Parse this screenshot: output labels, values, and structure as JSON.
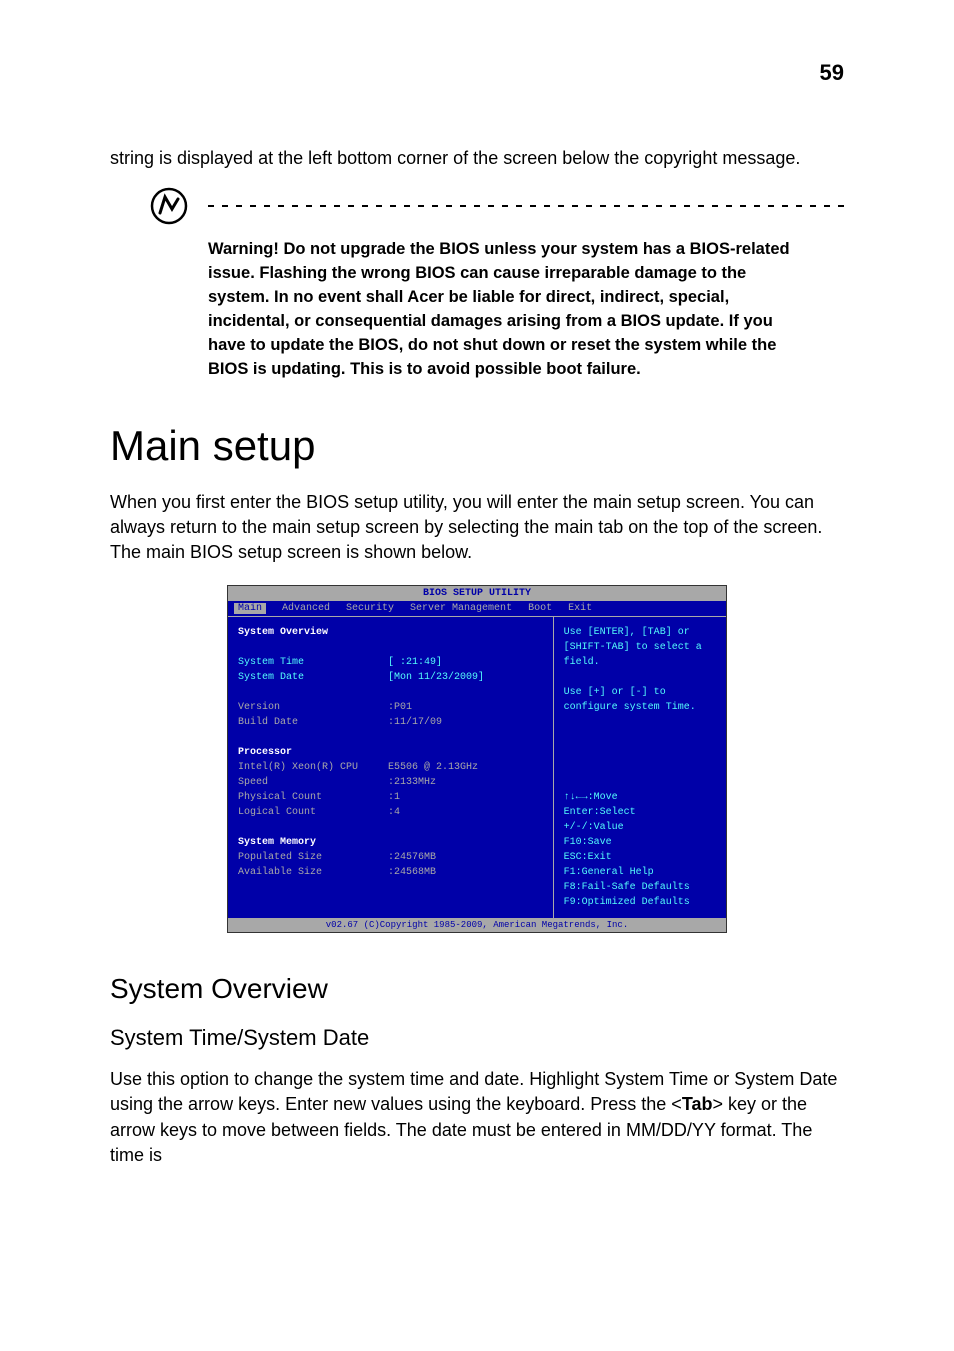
{
  "page_number": "59",
  "intro_text": "string is displayed at the left bottom corner of the screen below the copyright message.",
  "warning_text": "Warning! Do not upgrade the BIOS unless your system has a BIOS-related issue. Flashing the wrong BIOS can cause irreparable damage to the system. In no event shall Acer be liable for direct, indirect, special, incidental, or consequential damages arising from a BIOS update. If you have to update the BIOS, do not shut down or reset the system while the BIOS is updating. This is to avoid possible boot failure.",
  "main_heading": "Main setup",
  "main_body": "When you first enter the BIOS setup utility, you will enter the main setup screen. You can always return to the main setup screen by selecting the main tab on the top of the screen. The main BIOS setup screen is shown below.",
  "bios": {
    "title": "BIOS SETUP UTILITY",
    "menu": [
      "Main",
      "Advanced",
      "Security",
      "Server Management",
      "Boot",
      "Exit"
    ],
    "overview_title": "System Overview",
    "system_time_label": "System Time",
    "system_time_value": "[  :21:49]",
    "system_date_label": "System Date",
    "system_date_value": "[Mon 11/23/2009]",
    "version_label": "Version",
    "version_value": ":P01",
    "build_date_label": "Build Date",
    "build_date_value": ":11/17/09",
    "processor_title": "Processor",
    "cpu_label": "Intel(R) Xeon(R) CPU",
    "cpu_value": "E5506  @ 2.13GHz",
    "speed_label": "Speed",
    "speed_value": ":2133MHz",
    "phys_count_label": "Physical Count",
    "phys_count_value": ":1",
    "log_count_label": "Logical Count",
    "log_count_value": ":4",
    "memory_title": "System Memory",
    "populated_label": "Populated Size",
    "populated_value": ":24576MB",
    "available_label": "Available Size",
    "available_value": ":24568MB",
    "help_text1": "Use [ENTER], [TAB] or [SHIFT-TAB] to select a field.",
    "help_text2": "Use [+] or [-] to configure system Time.",
    "nav_move": "↑↓←→:Move",
    "nav_select": "Enter:Select",
    "nav_value": "+/-/:Value",
    "nav_save": "F10:Save",
    "nav_exit": "ESC:Exit",
    "nav_help": "F1:General Help",
    "nav_failsafe": "F8:Fail-Safe Defaults",
    "nav_optimized": "F9:Optimized Defaults",
    "footer": "v02.67 (C)Copyright 1985-2009, American Megatrends, Inc."
  },
  "section_heading": "System Overview",
  "sub_heading": "System Time/System Date",
  "sub_body_1": "Use this option to change the system time and date. Highlight System Time or System Date using the arrow keys. Enter new values using the keyboard. Press the <",
  "sub_body_tab": "Tab",
  "sub_body_2": "> key or the arrow keys to move between fields. The date must be entered in MM/DD/YY format. The time is"
}
